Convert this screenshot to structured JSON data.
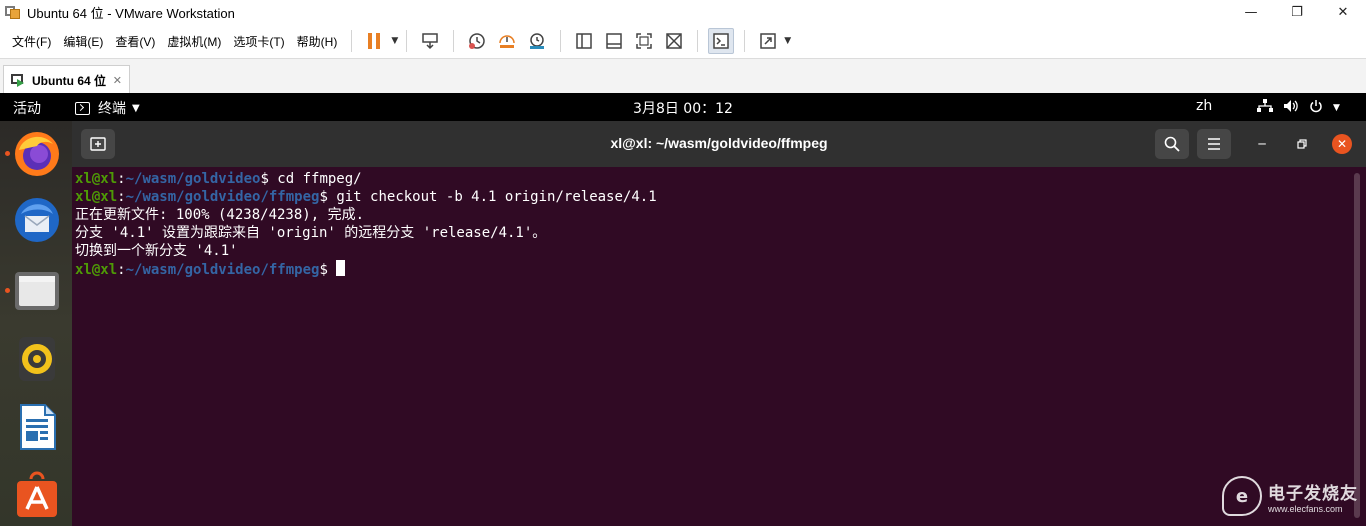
{
  "window": {
    "title": "Ubuntu 64 位 - VMware Workstation",
    "minimize_glyph": "—",
    "maximize_glyph": "❐",
    "close_glyph": "✕"
  },
  "menu": [
    "文件(F)",
    "编辑(E)",
    "查看(V)",
    "虚拟机(M)",
    "选项卡(T)",
    "帮助(H)"
  ],
  "toolbar": {
    "icons": [
      "pause-icon",
      "send-ctrl-alt-del-icon",
      "snapshot-take-icon",
      "snapshot-revert-icon",
      "snapshot-manager-icon",
      "sidebar-icon",
      "thumbnail-bar-icon",
      "full-screen-icon",
      "unity-icon",
      "console-view-icon",
      "stretch-guest-icon"
    ],
    "accent": "#e87f24"
  },
  "tab": {
    "label": "Ubuntu 64 位",
    "close_glyph": "✕"
  },
  "gnome": {
    "activities": "活动",
    "app_menu": "终端",
    "clock": "3月8日  00：12",
    "lang": "zh",
    "accent": "#e95420"
  },
  "dock": {
    "items": [
      "firefox-icon",
      "thunderbird-icon",
      "files-icon",
      "rhythmbox-icon",
      "libreoffice-writer-icon",
      "ubuntu-software-icon"
    ]
  },
  "terminal": {
    "title": "xl@xl: ~/wasm/goldvideo/ffmpeg",
    "background": "#300a24",
    "lines": [
      {
        "user": "xl@xl",
        "sep": ":",
        "path": "~/wasm/goldvideo",
        "cmd": "$ cd ffmpeg/"
      },
      {
        "user": "xl@xl",
        "sep": ":",
        "path": "~/wasm/goldvideo/ffmpeg",
        "cmd": "$ git checkout -b 4.1 origin/release/4.1"
      },
      {
        "text": "正在更新文件: 100% (4238/4238), 完成."
      },
      {
        "text": "分支 '4.1' 设置为跟踪来自 'origin' 的远程分支 'release/4.1'。"
      },
      {
        "text": "切换到一个新分支 '4.1'"
      },
      {
        "user": "xl@xl",
        "sep": ":",
        "path": "~/wasm/goldvideo/ffmpeg",
        "cmd": "$ "
      }
    ]
  },
  "watermark": {
    "cn": "电子发烧友",
    "en": "www.elecfans.com"
  }
}
